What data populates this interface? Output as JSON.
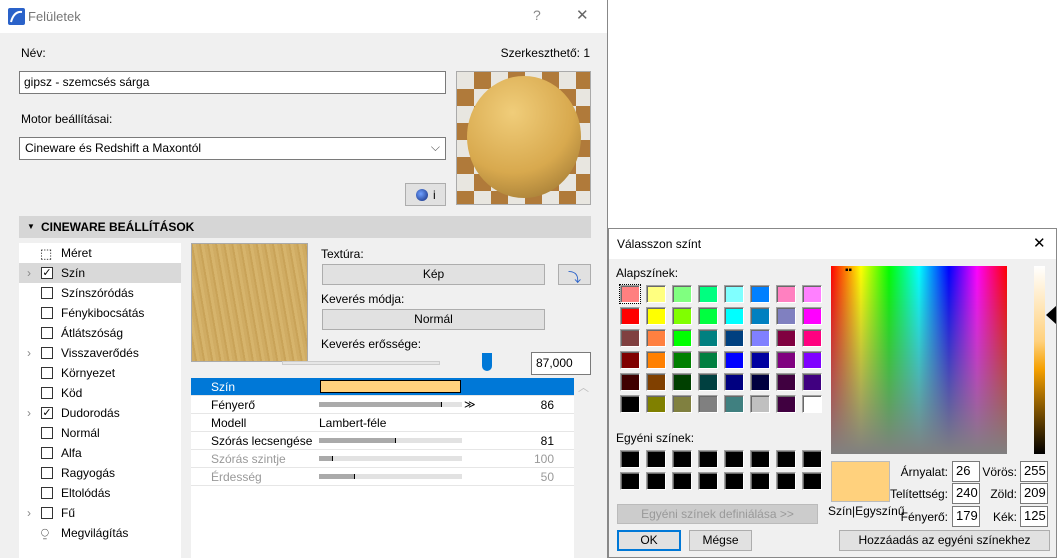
{
  "main": {
    "title": "Felületek",
    "help": "?",
    "close": "✕",
    "name_label": "Név:",
    "editable": "Szerkeszthető: 1",
    "name_value": "gipsz - szemcsés sárga",
    "engine_label": "Motor beállításai:",
    "engine_value": "Cineware és Redshift a Maxontól",
    "info_button": "i",
    "section": "CINEWARE BEÁLLÍTÁSOK",
    "tree": [
      {
        "label": "Méret",
        "type": "icon-size",
        "chev": false
      },
      {
        "label": "Szín",
        "checked": true,
        "chev": true,
        "selected": true
      },
      {
        "label": "Színszóródás",
        "checked": false
      },
      {
        "label": "Fénykibocsátás",
        "checked": false
      },
      {
        "label": "Átlátszóság",
        "checked": false
      },
      {
        "label": "Visszaverődés",
        "checked": false,
        "chev": true
      },
      {
        "label": "Környezet",
        "checked": false
      },
      {
        "label": "Köd",
        "checked": false
      },
      {
        "label": "Dudorodás",
        "checked": true,
        "chev": true
      },
      {
        "label": "Normál",
        "checked": false
      },
      {
        "label": "Alfa",
        "checked": false
      },
      {
        "label": "Ragyogás",
        "checked": false
      },
      {
        "label": "Eltolódás",
        "checked": false
      },
      {
        "label": "Fű",
        "checked": false,
        "chev": true
      },
      {
        "label": "Megvilágítás",
        "type": "icon-light"
      }
    ],
    "texture_label": "Textúra:",
    "texture_button": "Kép",
    "blend_mode_label": "Keverés módja:",
    "blend_mode_button": "Normál",
    "blend_strength_label": "Keverés erőssége:",
    "blend_strength_value": "87,000",
    "blend_strength_percent": 87,
    "props": [
      {
        "label": "Szín",
        "type": "color",
        "color": "#ffd17d"
      },
      {
        "label": "Fényerő",
        "value": "86",
        "fill": 86,
        "arrow": true
      },
      {
        "label": "Modell",
        "text": "Lambert-féle"
      },
      {
        "label": "Szórás lecsengése",
        "value": "81",
        "fill": 54
      },
      {
        "label": "Szórás szintje",
        "value": "100",
        "fill": 10,
        "dim": true
      },
      {
        "label": "Érdesség",
        "value": "50",
        "fill": 25,
        "dim": true
      }
    ]
  },
  "color_dialog": {
    "title": "Válasszon színt",
    "close": "✕",
    "basic_label": "Alapszínek:",
    "basic_colors": [
      "#FF8080",
      "#FFFF80",
      "#80FF80",
      "#00FF80",
      "#80FFFF",
      "#0080FF",
      "#FF80C0",
      "#FF80FF",
      "#FF0000",
      "#FFFF00",
      "#80FF00",
      "#00FF40",
      "#00FFFF",
      "#0080C0",
      "#8080C0",
      "#FF00FF",
      "#804040",
      "#FF8040",
      "#00FF00",
      "#008080",
      "#004080",
      "#8080FF",
      "#800040",
      "#FF0080",
      "#800000",
      "#FF8000",
      "#008000",
      "#008040",
      "#0000FF",
      "#0000A0",
      "#800080",
      "#8000FF",
      "#400000",
      "#804000",
      "#004000",
      "#004040",
      "#000080",
      "#000040",
      "#400040",
      "#400080",
      "#000000",
      "#808000",
      "#808040",
      "#808080",
      "#408080",
      "#C0C0C0",
      "#400040",
      "#FFFFFF"
    ],
    "custom_label": "Egyéni színek:",
    "custom_colors": [
      "#000000",
      "#000000",
      "#000000",
      "#000000",
      "#000000",
      "#000000",
      "#000000",
      "#000000",
      "#000000",
      "#000000",
      "#000000",
      "#000000",
      "#000000",
      "#000000",
      "#000000",
      "#000000"
    ],
    "define_button": "Egyéni színek definiálása >>",
    "ok": "OK",
    "cancel": "Mégse",
    "preview_color": "#FFD17D",
    "preview_label": "Szín|Egyszínű",
    "hue_label": "Árnyalat:",
    "hue": "26",
    "sat_label": "Telítettség:",
    "sat": "240",
    "lum_label": "Fényerő:",
    "lum": "179",
    "red_label": "Vörös:",
    "red": "255",
    "green_label": "Zöld:",
    "green": "209",
    "blue_label": "Kék:",
    "blue": "125",
    "add_button": "Hozzáadás az egyéni színekhez"
  }
}
